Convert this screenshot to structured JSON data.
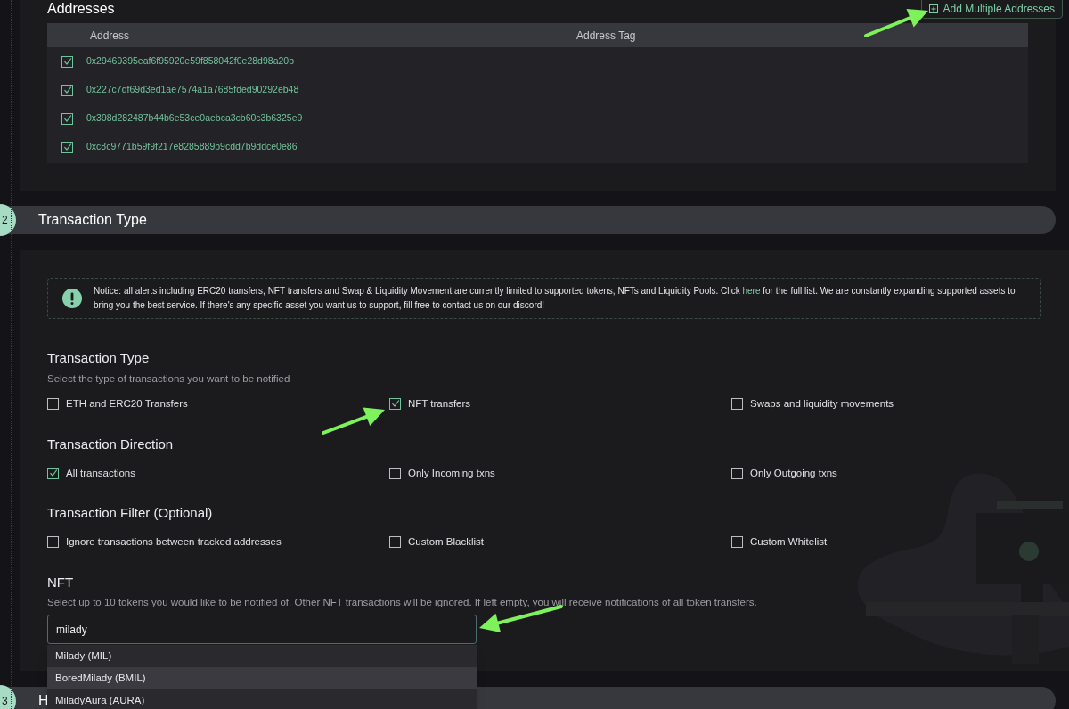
{
  "addresses": {
    "title": "Addresses",
    "add_button": "Add Multiple Addresses",
    "columns": [
      "Address",
      "Address Tag"
    ],
    "rows": [
      {
        "address": "0x29469395eaf6f95920e59f858042f0e28d98a20b",
        "checked": true
      },
      {
        "address": "0x227c7df69d3ed1ae7574a1a7685fded90292eb48",
        "checked": true
      },
      {
        "address": "0x398d282487b44b6e53ce0aebca3cb60c3b6325e9",
        "checked": true
      },
      {
        "address": "0xc8c9771b59f9f217e8285889b9cdd7b9ddce0e86",
        "checked": true
      }
    ]
  },
  "section_2": {
    "number": "2",
    "title": "Transaction Type"
  },
  "notice": {
    "text_before": "Notice: all alerts including ERC20 transfers, NFT transfers and Swap & Liquidity Movement are currently limited to supported tokens, NFTs and Liquidity Pools. Click",
    "link": "here",
    "text_after": "for the full list. We are constantly expanding supported assets to bring you the best service. If there's any specific asset you want us to support, fill free to contact us on our discord!"
  },
  "transaction_type": {
    "title": "Transaction Type",
    "hint": "Select the type of transactions you want to be notified",
    "options": [
      {
        "label": "ETH and ERC20 Transfers",
        "checked": false
      },
      {
        "label": "NFT transfers",
        "checked": true
      },
      {
        "label": "Swaps and liquidity movements",
        "checked": false
      }
    ]
  },
  "transaction_direction": {
    "title": "Transaction Direction",
    "options": [
      {
        "label": "All transactions",
        "checked": true
      },
      {
        "label": "Only Incoming txns",
        "checked": false
      },
      {
        "label": "Only Outgoing txns",
        "checked": false
      }
    ]
  },
  "transaction_filter": {
    "title": "Transaction Filter (Optional)",
    "options": [
      {
        "label": "Ignore transactions between tracked addresses",
        "checked": false
      },
      {
        "label": "Custom Blacklist",
        "checked": false
      },
      {
        "label": "Custom Whitelist",
        "checked": false
      }
    ]
  },
  "nft": {
    "title": "NFT",
    "hint": "Select up to 10 tokens you would like to be notified of. Other NFT transactions will be ignored. If left empty, you will receive notifications of all token transfers.",
    "search": {
      "value": "milady"
    },
    "suggestions": [
      {
        "label": "Milady (MIL)",
        "selected": false
      },
      {
        "label": "BoredMilady (BMIL)",
        "selected": true
      },
      {
        "label": "MiladyAura (AURA)",
        "selected": false
      }
    ]
  },
  "section_3": {
    "number": "3",
    "title": "H"
  }
}
